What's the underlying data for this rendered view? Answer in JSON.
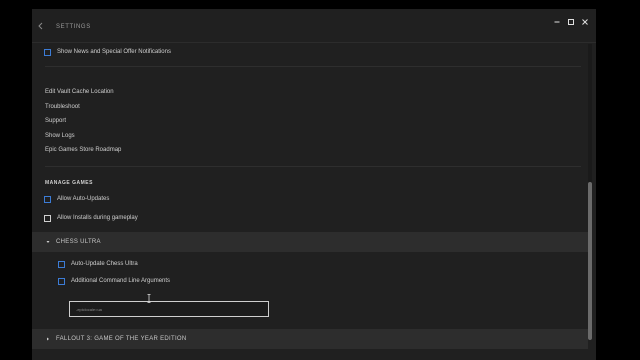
{
  "window": {
    "title": "SETTINGS"
  },
  "general": {
    "news_checkbox_label": "Show News and Special Offer Notifications",
    "links": [
      "Edit Vault Cache Location",
      "Troubleshoot",
      "Support",
      "Show Logs",
      "Epic Games Store Roadmap"
    ]
  },
  "manage_games": {
    "heading": "MANAGE GAMES",
    "auto_updates_label": "Allow Auto-Updates",
    "installs_gameplay_label": "Allow Installs during gameplay"
  },
  "games": [
    {
      "title": "CHESS ULTRA",
      "expanded": true,
      "auto_update_label": "Auto-Update Chess Ultra",
      "cmd_args_label": "Additional Command Line Arguments",
      "cmd_args_value": "-epiclocale=ua"
    },
    {
      "title": "FALLOUT 3: GAME OF THE YEAR EDITION",
      "expanded": false
    }
  ],
  "icons": {
    "back": "chevron-left-icon",
    "minimize": "minimize-icon",
    "maximize": "maximize-icon",
    "close": "close-icon",
    "expanded": "caret-down-icon",
    "collapsed": "caret-right-icon"
  },
  "colors": {
    "accent": "#3c7cd6",
    "background": "#202020",
    "game_header": "#2d2d2d"
  }
}
